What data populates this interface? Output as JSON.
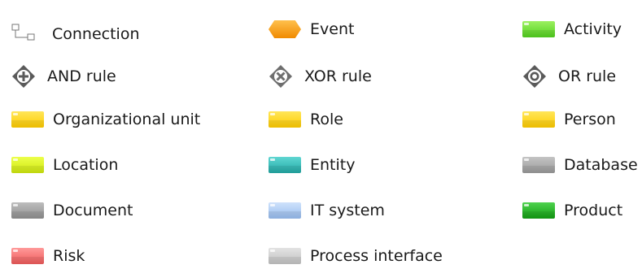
{
  "palette": {
    "items": [
      {
        "label": "Connection",
        "icon": "connection-icon"
      },
      {
        "label": "Event",
        "icon": "event-icon",
        "color": "#f59a10"
      },
      {
        "label": "Activity",
        "icon": "activity-icon",
        "color": "#6fe03a"
      },
      {
        "label": "AND rule",
        "icon": "and-rule-icon",
        "color": "#5a5a5a"
      },
      {
        "label": "XOR rule",
        "icon": "xor-rule-icon",
        "color": "#6e6e6e"
      },
      {
        "label": "OR rule",
        "icon": "or-rule-icon",
        "color": "#5a5a5a"
      },
      {
        "label": "Organizational unit",
        "icon": "organizational-unit-icon",
        "color": "#ffd21a"
      },
      {
        "label": "Role",
        "icon": "role-icon",
        "color": "#ffd21a"
      },
      {
        "label": "Person",
        "icon": "person-icon",
        "color": "#ffd21a"
      },
      {
        "label": "Location",
        "icon": "location-icon",
        "color": "#d7f21b"
      },
      {
        "label": "Entity",
        "icon": "entity-icon",
        "color": "#2fb8b4"
      },
      {
        "label": "Database",
        "icon": "database-icon",
        "color": "#a5a5a5"
      },
      {
        "label": "Document",
        "icon": "document-icon",
        "color": "#9c9c9c"
      },
      {
        "label": "IT system",
        "icon": "it-system-icon",
        "color": "#a9c9f5"
      },
      {
        "label": "Product",
        "icon": "product-icon",
        "color": "#1fb01f"
      },
      {
        "label": "Risk",
        "icon": "risk-icon",
        "color": "#f26d6d"
      },
      {
        "label": "Process interface",
        "icon": "process-interface-icon",
        "color": "#cfcfcf"
      }
    ]
  }
}
